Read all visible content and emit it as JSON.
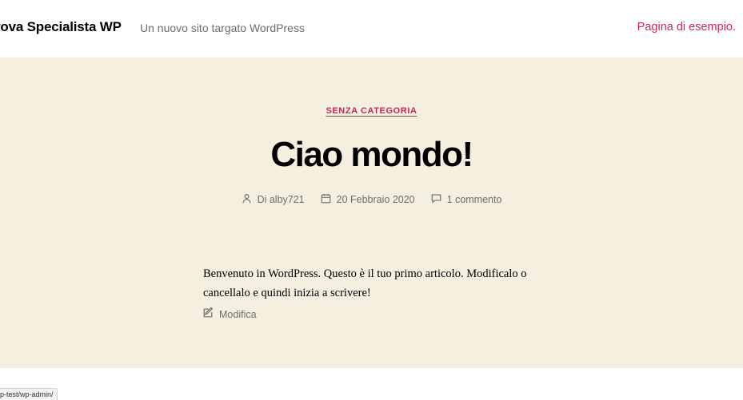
{
  "header": {
    "site_title": "rova Specialista WP",
    "site_description": "Un nuovo sito targato WordPress",
    "nav_link": "Pagina di esempio."
  },
  "post": {
    "category": "SENZA CATEGORIA",
    "title": "Ciao mondo!",
    "meta": {
      "author": "Di alby721",
      "date": "20 Febbraio 2020",
      "comments": "1 commento"
    },
    "content": "Benvenuto in WordPress. Questo è il tuo primo articolo. Modificalo o cancellalo e quindi inizia a scrivere!",
    "edit_label": "Modifica"
  },
  "status_bar": {
    "url": "p-test/wp-admin/"
  },
  "colors": {
    "accent": "#cd2653",
    "hero_bg": "#f5efe0",
    "meta_text": "#6d6d6d"
  },
  "icons": {
    "author": "user-icon",
    "date": "calendar-icon",
    "comments": "comment-icon",
    "edit": "edit-icon"
  }
}
